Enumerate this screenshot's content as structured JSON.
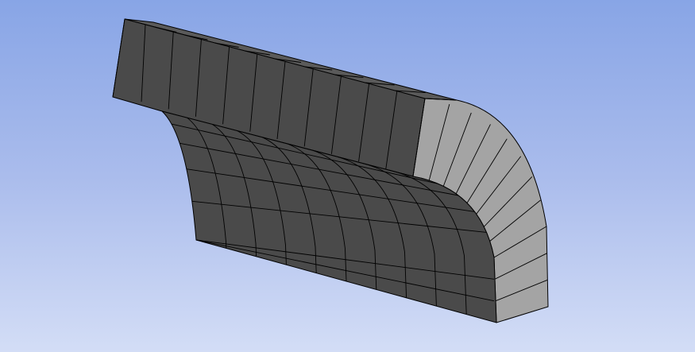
{
  "viewport": {
    "background_top": "#88a5e6",
    "background_bottom": "#d3ddf6"
  },
  "model": {
    "dark_face_color": "#4a4a4a",
    "light_face_color": "#a4a4a4",
    "edge_color": "#000000"
  }
}
